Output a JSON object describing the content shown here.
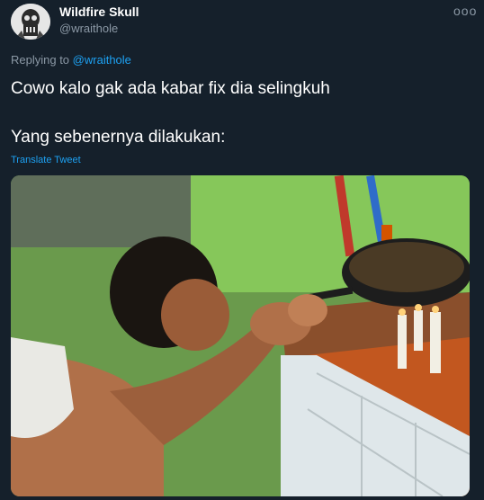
{
  "tweet": {
    "author_name": "Wildfire Skull",
    "author_handle": "@wraithole",
    "more_label": "ooo",
    "replying_prefix": "Replying to",
    "replying_to": "@wraithole",
    "text_line1": "Cowo kalo gak ada kabar fix dia selingkuh",
    "text_line2": "Yang sebenernya dilakukan:",
    "translate_label": "Translate Tweet"
  },
  "media": {
    "description_icon": "photo"
  },
  "colors": {
    "background": "#15202b",
    "link": "#1da1f2",
    "secondary_text": "#8b98a5",
    "primary_text": "#ffffff"
  }
}
